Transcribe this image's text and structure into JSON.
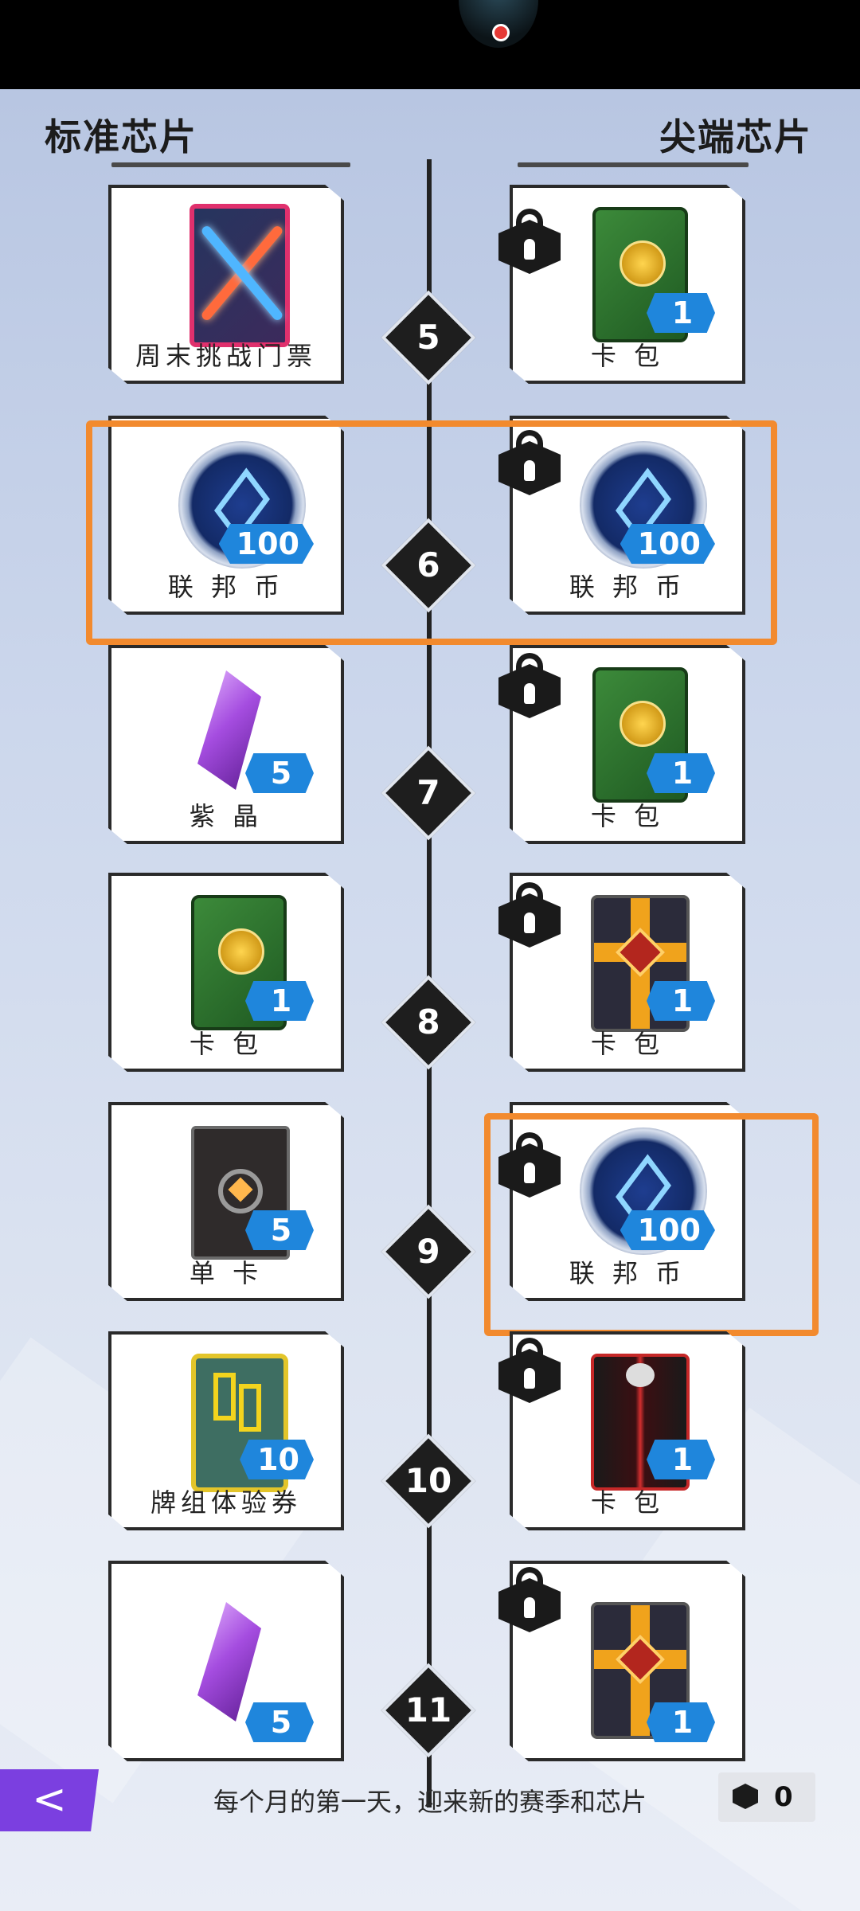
{
  "header": {
    "left_title": "标准芯片",
    "right_title": "尖端芯片"
  },
  "rows": [
    {
      "level": "5",
      "left": {
        "label": "周末挑战门票",
        "badge": ""
      },
      "right": {
        "label": "卡 包",
        "badge": "1"
      }
    },
    {
      "level": "6",
      "left": {
        "label": "联 邦 币",
        "badge": "100"
      },
      "right": {
        "label": "联 邦 币",
        "badge": "100"
      }
    },
    {
      "level": "7",
      "left": {
        "label": "紫 晶",
        "badge": "5"
      },
      "right": {
        "label": "卡 包",
        "badge": "1"
      }
    },
    {
      "level": "8",
      "left": {
        "label": "卡 包",
        "badge": "1"
      },
      "right": {
        "label": "卡 包",
        "badge": "1"
      }
    },
    {
      "level": "9",
      "left": {
        "label": "单 卡",
        "badge": "5"
      },
      "right": {
        "label": "联 邦 币",
        "badge": "100"
      }
    },
    {
      "level": "10",
      "left": {
        "label": "牌组体验券",
        "badge": "10"
      },
      "right": {
        "label": "卡 包",
        "badge": "1"
      }
    },
    {
      "level": "11",
      "left": {
        "label": "",
        "badge": "5"
      },
      "right": {
        "label": "",
        "badge": "1"
      }
    }
  ],
  "footer": {
    "back_icon": "<",
    "text": "每个月的第一天，迎来新的赛季和芯片",
    "chip_count": "0"
  },
  "colors": {
    "highlight": "#f28a2e",
    "badge": "#1f86dc",
    "back_button": "#7b3fe0"
  }
}
